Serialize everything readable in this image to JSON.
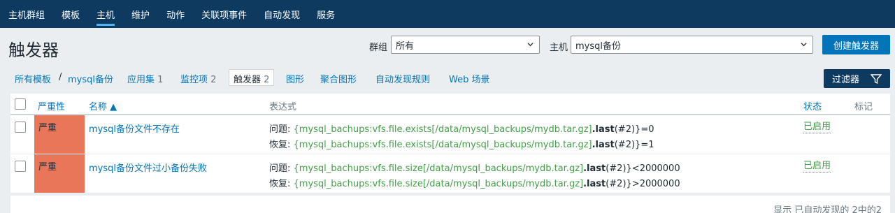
{
  "topnav": [
    "主机群组",
    "模板",
    "主机",
    "维护",
    "动作",
    "关联项事件",
    "自动发现",
    "服务"
  ],
  "header": {
    "title": "触发器",
    "group_label": "群组",
    "group_value": "所有",
    "host_label": "主机",
    "host_value": "mysql备份",
    "create_button": "创建触发器"
  },
  "subnav": {
    "crumb_all_templates": "所有模板",
    "crumb_sep": "/",
    "crumb_host": "mysql备份",
    "tabs": [
      {
        "label": "应用集",
        "count": "1"
      },
      {
        "label": "监控项",
        "count": "2"
      },
      {
        "label": "触发器",
        "count": "2"
      },
      {
        "label": "图形",
        "count": ""
      },
      {
        "label": "聚合图形",
        "count": ""
      },
      {
        "label": "自动发现规则",
        "count": ""
      },
      {
        "label": "Web 场景",
        "count": ""
      }
    ],
    "filter_button": "过滤器"
  },
  "table": {
    "headers": {
      "severity": "严重性",
      "name": "名称 ▲",
      "expression": "表达式",
      "status": "状态",
      "tags": "标记"
    },
    "rows": [
      {
        "severity": "严重",
        "name": "mysql备份文件不存在",
        "problem_label": "问题:",
        "problem_item": "{mysql_bachups:vfs.file.exists[/data/mysql_backups/mydb.tar.gz]",
        "problem_func": ".last",
        "problem_tail": "(#2)}=0",
        "recovery_label": "恢复:",
        "recovery_item": "{mysql_bachups:vfs.file.exists[/data/mysql_backups/mydb.tar.gz]",
        "recovery_func": ".last",
        "recovery_tail": "(#2)}=1",
        "status": "已启用"
      },
      {
        "severity": "严重",
        "name": "mysql备份文件过小备份失败",
        "problem_label": "问题:",
        "problem_item": "{mysql_bachups:vfs.file.size[/data/mysql_backups/mydb.tar.gz]",
        "problem_func": ".last",
        "problem_tail": "(#2)}<2000000",
        "recovery_label": "恢复:",
        "recovery_item": "{mysql_bachups:vfs.file.size[/data/mysql_backups/mydb.tar.gz]",
        "recovery_func": ".last",
        "recovery_tail": "(#2)}>2000000",
        "status": "已启用"
      }
    ],
    "footer": "显示 已自动发现的 2中的2"
  },
  "colors": {
    "nav_bg": "#0e3a5f",
    "accent": "#0275b8",
    "severity_high": "#e97659",
    "enabled": "#429e47"
  }
}
